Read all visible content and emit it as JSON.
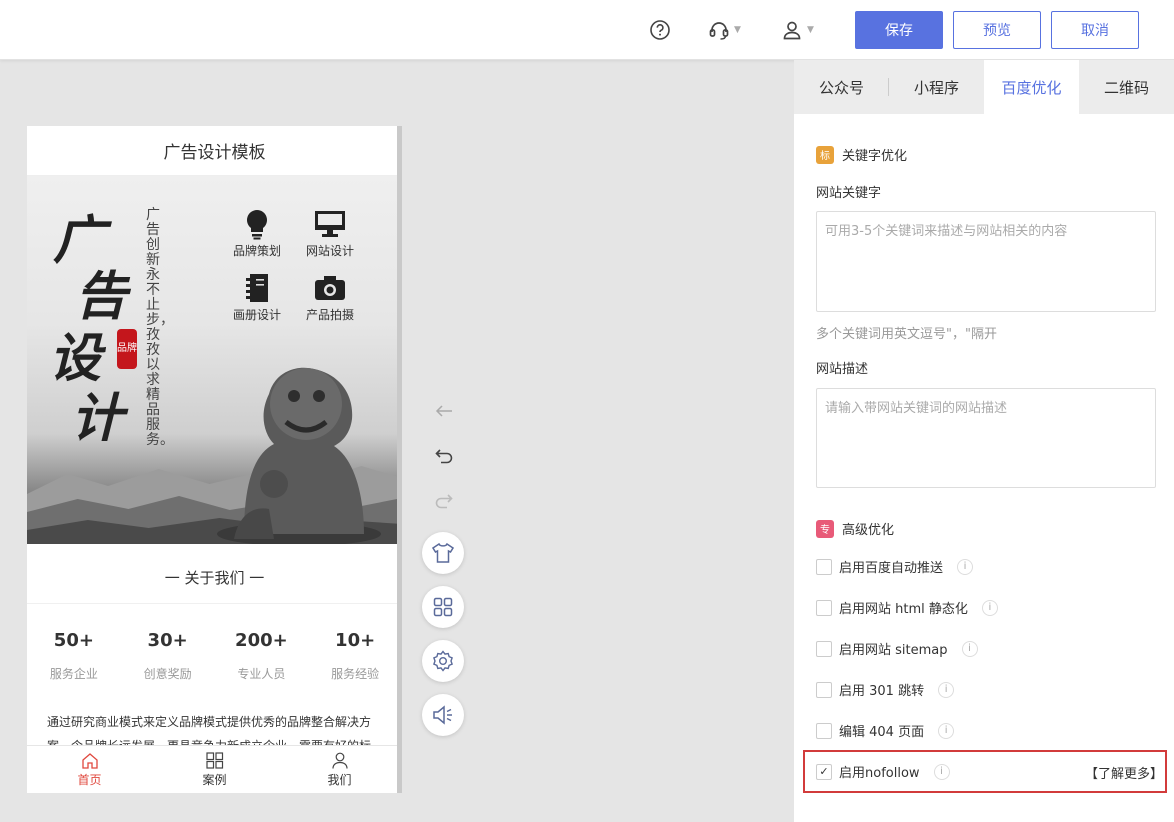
{
  "toolbar": {
    "help_icon": "question-circle-icon",
    "support_icon": "headset-icon",
    "user_icon": "user-icon",
    "save_label": "保存",
    "preview_label": "预览",
    "cancel_label": "取消"
  },
  "phone": {
    "title": "广告设计模板",
    "banner": {
      "big_chars": [
        "广",
        "告",
        "设",
        "计"
      ],
      "seal_text": "品牌",
      "slogan": "广告创新永不止步，孜孜以求精品服务。",
      "services": [
        {
          "label": "品牌策划",
          "icon": "lightbulb-icon"
        },
        {
          "label": "网站设计",
          "icon": "monitor-icon"
        },
        {
          "label": "画册设计",
          "icon": "notebook-icon"
        },
        {
          "label": "产品拍摄",
          "icon": "camera-icon"
        }
      ]
    },
    "about_title": "一 关于我们 一",
    "stats": [
      {
        "num": "50+",
        "label": "服务企业"
      },
      {
        "num": "30+",
        "label": "创意奖励"
      },
      {
        "num": "200+",
        "label": "专业人员"
      },
      {
        "num": "10+",
        "label": "服务经验"
      }
    ],
    "intro": "通过研究商业模式来定义品牌模式提供优秀的品牌整合解决方案，令品牌长远发展，更具竞争力新成立企业，需要有好的标",
    "nav": [
      {
        "label": "首页",
        "icon": "home-icon",
        "active": true
      },
      {
        "label": "案例",
        "icon": "grid-icon",
        "active": false
      },
      {
        "label": "我们",
        "icon": "person-icon",
        "active": false
      }
    ]
  },
  "tools": [
    "arrow-left-icon",
    "undo-icon",
    "redo-icon",
    "shirt-icon",
    "apps-icon",
    "settings-icon",
    "speaker-icon"
  ],
  "panel": {
    "tabs": [
      "公众号",
      "小程序",
      "百度优化",
      "二维码"
    ],
    "active_tab": 2,
    "keyword_section": {
      "badge": "标",
      "title": "关键字优化",
      "keywords_label": "网站关键字",
      "keywords_placeholder": "可用3-5个关键词来描述与网站相关的内容",
      "keywords_hint": "多个关键词用英文逗号\"，\"隔开",
      "desc_label": "网站描述",
      "desc_placeholder": "请输入带网站关键词的网站描述"
    },
    "advanced_section": {
      "badge": "专",
      "title": "高级优化",
      "options": [
        {
          "label": "启用百度自动推送",
          "checked": false
        },
        {
          "label": "启用网站 html 静态化",
          "checked": false
        },
        {
          "label": "启用网站 sitemap",
          "checked": false
        },
        {
          "label": "启用 301 跳转",
          "checked": false
        },
        {
          "label": "编辑 404 页面",
          "checked": false
        },
        {
          "label": "启用nofollow",
          "checked": true
        }
      ],
      "info_mark": "i",
      "learn_more": "【了解更多】"
    }
  },
  "colors": {
    "accent": "#5872e0",
    "active_nav": "#e0483e",
    "highlight_border": "#d23b3b",
    "badge_keyword": "#e8a23a",
    "badge_advanced": "#e85a78"
  }
}
